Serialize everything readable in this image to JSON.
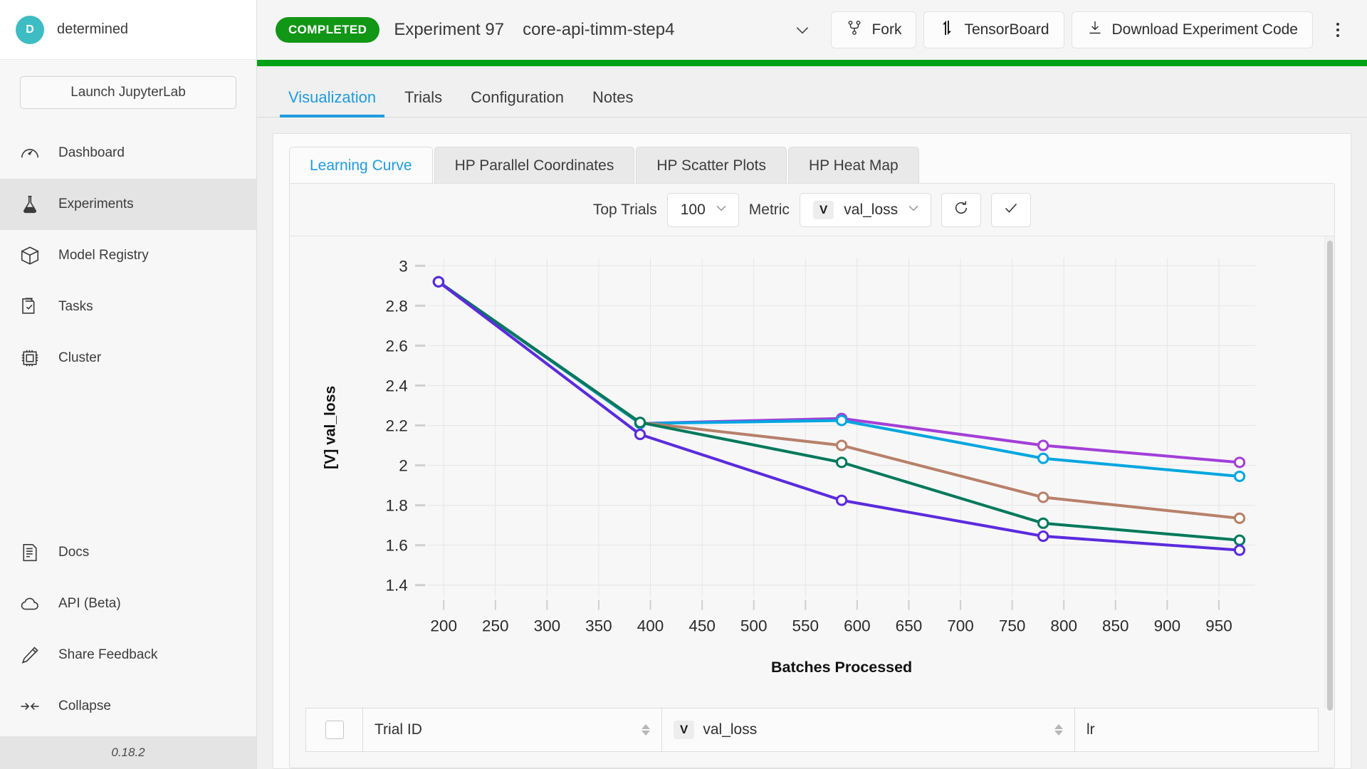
{
  "sidebar": {
    "brand": {
      "initial": "D",
      "name": "determined"
    },
    "jupyter_button": "Launch JupyterLab",
    "items": [
      {
        "label": "Dashboard",
        "icon": "gauge-icon"
      },
      {
        "label": "Experiments",
        "icon": "flask-icon"
      },
      {
        "label": "Model Registry",
        "icon": "cube-icon"
      },
      {
        "label": "Tasks",
        "icon": "tasks-icon"
      },
      {
        "label": "Cluster",
        "icon": "chip-icon"
      }
    ],
    "bottom_items": [
      {
        "label": "Docs",
        "icon": "document-icon"
      },
      {
        "label": "API (Beta)",
        "icon": "cloud-icon"
      },
      {
        "label": "Share Feedback",
        "icon": "pencil-icon"
      },
      {
        "label": "Collapse",
        "icon": "collapse-icon"
      }
    ],
    "version": "0.18.2"
  },
  "header": {
    "status_badge": "COMPLETED",
    "experiment_title": "Experiment 97",
    "experiment_name": "core-api-timm-step4",
    "fork_label": "Fork",
    "tensorboard_label": "TensorBoard",
    "download_label": "Download Experiment Code",
    "progress_color": "#00a218",
    "status_color": "#119615"
  },
  "tabs": [
    {
      "label": "Visualization",
      "active": true
    },
    {
      "label": "Trials",
      "active": false
    },
    {
      "label": "Configuration",
      "active": false
    },
    {
      "label": "Notes",
      "active": false
    }
  ],
  "subtabs": [
    {
      "label": "Learning Curve",
      "active": true
    },
    {
      "label": "HP Parallel Coordinates",
      "active": false
    },
    {
      "label": "HP Scatter Plots",
      "active": false
    },
    {
      "label": "HP Heat Map",
      "active": false
    }
  ],
  "chart_toolbar": {
    "top_trials_label": "Top Trials",
    "top_trials_value": "100",
    "metric_label": "Metric",
    "metric_badge": "V",
    "metric_value": "val_loss"
  },
  "table": {
    "columns": [
      {
        "key": "trial_id",
        "label": "Trial ID",
        "sortable": true
      },
      {
        "key": "val_loss",
        "label": "val_loss",
        "badge": "V",
        "sortable": true
      },
      {
        "key": "lr",
        "label": "lr",
        "sortable": false
      }
    ]
  },
  "chart_data": {
    "type": "line",
    "title": "",
    "xlabel": "Batches Processed",
    "ylabel": "[V] val_loss",
    "xlim": [
      185,
      985
    ],
    "ylim": [
      1.34,
      3.04
    ],
    "xticks": [
      200,
      250,
      300,
      350,
      400,
      450,
      500,
      550,
      600,
      650,
      700,
      750,
      800,
      850,
      900,
      950
    ],
    "yticks": [
      1.4,
      1.6,
      1.8,
      2.0,
      2.2,
      2.4,
      2.6,
      2.8,
      3.0
    ],
    "ytick_labels": [
      "1.4",
      "1.6",
      "1.8",
      "2",
      "2.2",
      "2.4",
      "2.6",
      "2.8",
      "3"
    ],
    "grid": true,
    "legend": "none",
    "x": [
      195,
      390,
      585,
      780,
      970
    ],
    "series": [
      {
        "name": "trial-purple-light",
        "color": "#a33fd8",
        "values": [
          2.92,
          2.21,
          2.235,
          2.1,
          2.015
        ]
      },
      {
        "name": "trial-cyan",
        "color": "#00a6e0",
        "values": [
          2.92,
          2.21,
          2.225,
          2.035,
          1.945
        ]
      },
      {
        "name": "trial-brown",
        "color": "#b8806a",
        "values": [
          2.92,
          2.215,
          2.1,
          1.84,
          1.735
        ]
      },
      {
        "name": "trial-green",
        "color": "#00795c",
        "values": [
          2.92,
          2.215,
          2.015,
          1.71,
          1.625
        ]
      },
      {
        "name": "trial-violet",
        "color": "#5b2bdd",
        "values": [
          2.92,
          2.155,
          1.825,
          1.645,
          1.575
        ]
      }
    ]
  }
}
